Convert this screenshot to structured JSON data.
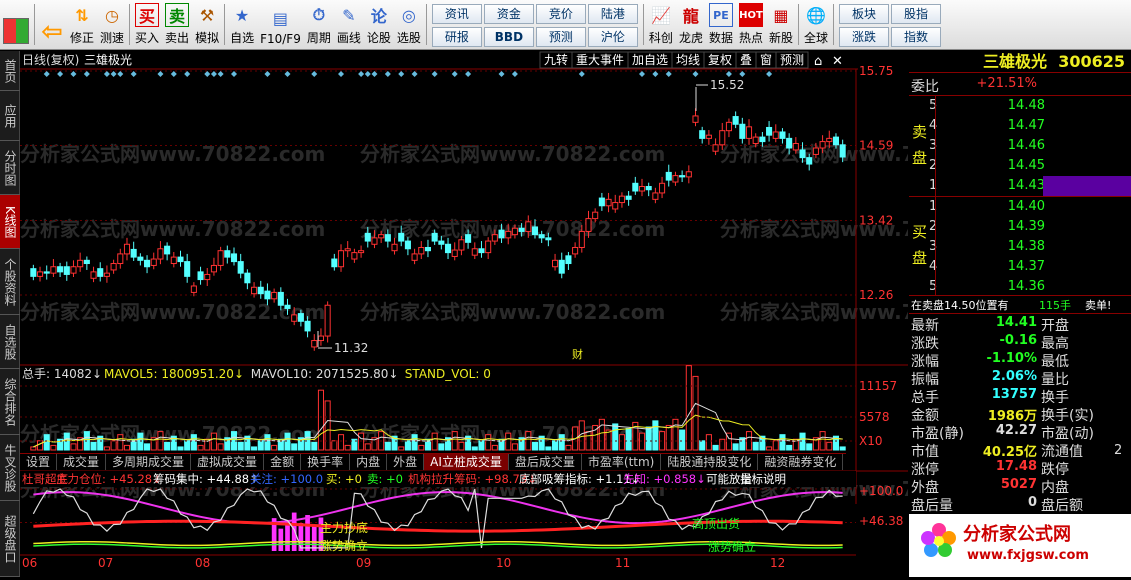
{
  "toolbar": {
    "home_label": "",
    "back_label": "",
    "items": [
      "修正",
      "测速",
      "买入",
      "卖出",
      "模拟",
      "自选",
      "F10/F9",
      "周期",
      "画线",
      "论股",
      "选股"
    ],
    "mini1": [
      "资讯",
      "资金",
      "竞价",
      "陆港",
      "研报",
      "BBD",
      "预测",
      "沪伦"
    ],
    "items2": [
      "科创",
      "龙虎",
      "数据",
      "热点",
      "新股",
      "全球"
    ],
    "mini2": [
      "板块",
      "股指",
      "涨跌",
      "指数"
    ]
  },
  "sidetabs": [
    "首页",
    "应用",
    "分时图",
    "K线图",
    "个股资料",
    "自选股",
    "综合排名",
    "牛叉诊股",
    "超级盘口"
  ],
  "chart": {
    "title_left": "日线(复权)",
    "stock": "三雄极光",
    "toolbar_right": [
      "九转",
      "重大事件",
      "加自选",
      "均线",
      "复权",
      "叠",
      "窗",
      "预测"
    ],
    "price_ticks": [
      "15.75",
      "14.59",
      "13.42",
      "12.26"
    ],
    "high_label": "15.52",
    "low_label": "11.32",
    "event_marker": "财",
    "watermark": "分析家公式网www.70822.com",
    "vol_header": [
      "总手: 14082↓",
      "MAVOL5: 1800951.20↓",
      "MAVOL10: 2071525.80↓",
      "STAND_VOL: 0"
    ],
    "vol_ticks": [
      "11157",
      "5578",
      "X10"
    ],
    "ind_header": [
      "杜哥超底",
      "主力仓位: +45.28↓",
      "筹码集中: +44.88↑",
      "关注: +100.0",
      "买: +0",
      "卖: +0",
      "机构拉升筹码: +98.73↓",
      "底部吸筹指标: +1.11↓",
      "先知: +0.858↓",
      "可能放量",
      "指标说明"
    ],
    "ind_ticks": [
      "+100.0",
      "+46.38"
    ],
    "ind_labels": [
      "主力抄底",
      "涨势确立",
      "高顶出货",
      "涨势确立"
    ],
    "months": [
      "06",
      "07",
      "08",
      "09",
      "10",
      "11",
      "12"
    ]
  },
  "tabs": [
    "设置",
    "成交量",
    "多周期成交量",
    "虚拟成交量",
    "金额",
    "换手率",
    "内盘",
    "外盘",
    "AI立桩成交量",
    "盘后成交量",
    "市盈率(ttm)",
    "陆股通持股变化",
    "融资融券变化"
  ],
  "active_tab": "AI立桩成交量",
  "quote": {
    "name": "三雄极光",
    "code": "300625",
    "weibi_label": "委比",
    "weibi": "+21.51%",
    "sell_label": "卖盘",
    "buy_label": "买盘",
    "asks": [
      {
        "n": "5",
        "p": "14.48"
      },
      {
        "n": "4",
        "p": "14.47"
      },
      {
        "n": "3",
        "p": "14.46"
      },
      {
        "n": "2",
        "p": "14.45"
      },
      {
        "n": "1",
        "p": "14.43"
      }
    ],
    "bids": [
      {
        "n": "1",
        "p": "14.40"
      },
      {
        "n": "2",
        "p": "14.39"
      },
      {
        "n": "3",
        "p": "14.38"
      },
      {
        "n": "4",
        "p": "14.37"
      },
      {
        "n": "5",
        "p": "14.36"
      }
    ],
    "note": "在卖盘14.50位置有",
    "note_qty": "115手",
    "note_tag": "卖单!",
    "stats": [
      {
        "l": "最新",
        "v": "14.41",
        "r": "开盘"
      },
      {
        "l": "涨跌",
        "v": "-0.16",
        "r": "最高"
      },
      {
        "l": "涨幅",
        "v": "-1.10%",
        "r": "最低"
      },
      {
        "l": "振幅",
        "v": "2.06%",
        "r": "量比"
      },
      {
        "l": "总手",
        "v": "13757",
        "r": "换手"
      },
      {
        "l": "金额",
        "v": "1986万",
        "r": "换手(实)"
      },
      {
        "l": "市盈(静)",
        "v": "42.27",
        "r": "市盈(动)"
      },
      {
        "l": "市值",
        "v": "40.25亿",
        "r": "流通值"
      },
      {
        "l": "涨停",
        "v": "17.48",
        "r": "跌停"
      },
      {
        "l": "外盘",
        "v": "5027",
        "r": "内盘"
      },
      {
        "l": "盘后量",
        "v": "0",
        "r": "盘后额"
      }
    ],
    "trailing": "2"
  },
  "logo": {
    "name": "分析家公式网",
    "url": "www.fxjgsw.com"
  },
  "colors": {
    "up": "#ff3232",
    "down": "#54ffff",
    "accent": "#ee2"
  }
}
